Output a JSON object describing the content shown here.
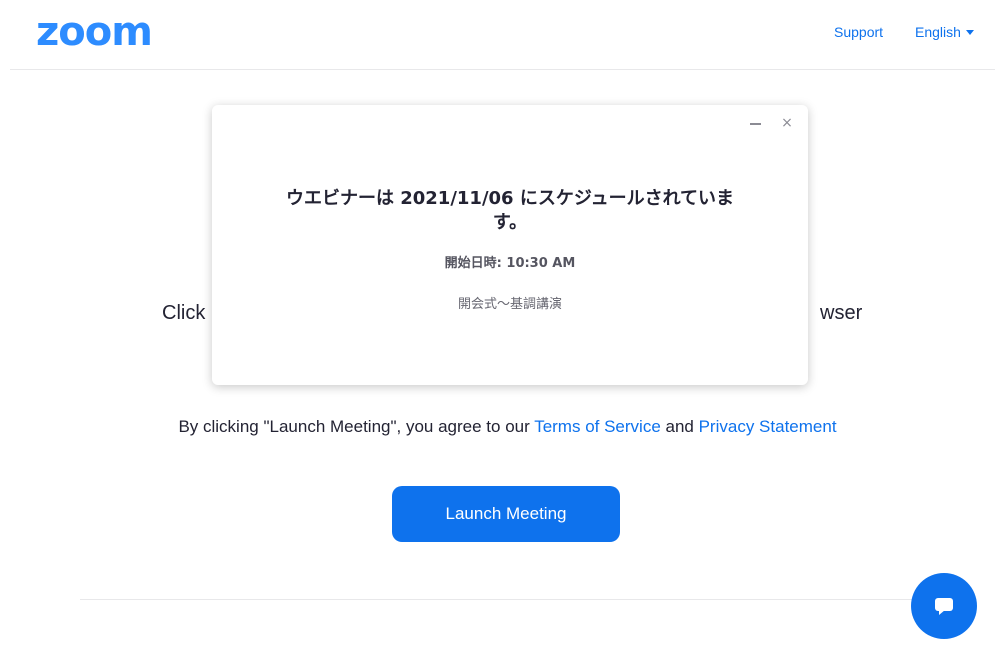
{
  "header": {
    "logo_text": "zoom",
    "support_label": "Support",
    "language_label": "English"
  },
  "background": {
    "line_left": "Click",
    "line_right": "wser"
  },
  "agreement": {
    "prefix": "By clicking \"Launch Meeting\", you agree to our ",
    "terms_link": "Terms of Service",
    "conjunction": " and ",
    "privacy_link": "Privacy Statement"
  },
  "launch_button_label": "Launch Meeting",
  "modal": {
    "title": "ウエビナーは 2021/11/06 にスケジュールされています。",
    "start_time": "開始日時: 10:30 AM",
    "description": "開会式～基調講演",
    "close_glyph": "×"
  },
  "colors": {
    "brand_blue": "#0e72ed",
    "logo_blue": "#2d8cff",
    "text_dark": "#232333"
  },
  "icons": {
    "minimize": "minimize-icon",
    "close": "close-icon",
    "chat": "chat-bubble-icon",
    "caret": "chevron-down-icon"
  }
}
